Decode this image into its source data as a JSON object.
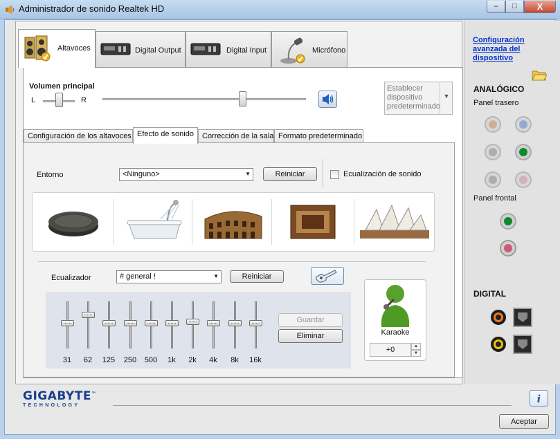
{
  "window": {
    "title": "Administrador de sonido Realtek HD",
    "min": "‒",
    "max": "□",
    "close": "X"
  },
  "tabs": [
    {
      "label": "Altavoces"
    },
    {
      "label": "Digital Output"
    },
    {
      "label": "Digital Input"
    },
    {
      "label": "Micrófono"
    }
  ],
  "volume": {
    "label": "Volumen principal",
    "left": "L",
    "right": "R",
    "balance": 0.5,
    "level": 0.67
  },
  "default_device": {
    "label": "Establecer dispositivo predeterminado"
  },
  "subtabs": [
    {
      "label": "Configuración de los altavoces"
    },
    {
      "label": "Efecto de sonido"
    },
    {
      "label": "Corrección de la sala"
    },
    {
      "label": "Formato predeterminado"
    }
  ],
  "environment": {
    "label": "Entorno",
    "selected": "<Ninguno>",
    "reset_label": "Reiniciar",
    "equalization_label": "Ecualización de sonido",
    "equalization_checked": false,
    "presets": [
      "stone-disc",
      "bathtub",
      "colosseum",
      "sewer-pipe",
      "opera-house"
    ]
  },
  "equalizer": {
    "label": "Ecualizador",
    "selected": "# general !",
    "reset_label": "Reiniciar",
    "save_label": "Guardar",
    "delete_label": "Eliminar",
    "bands": [
      {
        "freq": "31",
        "level": 0.45
      },
      {
        "freq": "62",
        "level": 0.28
      },
      {
        "freq": "125",
        "level": 0.45
      },
      {
        "freq": "250",
        "level": 0.45
      },
      {
        "freq": "500",
        "level": 0.45
      },
      {
        "freq": "1k",
        "level": 0.45
      },
      {
        "freq": "2k",
        "level": 0.42
      },
      {
        "freq": "4k",
        "level": 0.45
      },
      {
        "freq": "8k",
        "level": 0.45
      },
      {
        "freq": "16k",
        "level": 0.45
      }
    ]
  },
  "karaoke": {
    "label": "Karaoke",
    "value": "+0",
    "up": "▲",
    "down": "▼"
  },
  "brand": {
    "name": "GIGABYTE",
    "tm": "™",
    "sub": "TECHNOLOGY"
  },
  "buttons": {
    "accept": "Aceptar",
    "info": "i"
  },
  "right_panel": {
    "advanced_link": "Configuración avanzada del dispositivo",
    "analog_title": "ANALÓGICO",
    "rear_label": "Panel trasero",
    "front_label": "Panel frontal",
    "digital_title": "DIGITAL"
  },
  "colors": {
    "accent": "#1a3e8c",
    "link": "#0033cc",
    "jack_green": "#0e8a2a"
  }
}
